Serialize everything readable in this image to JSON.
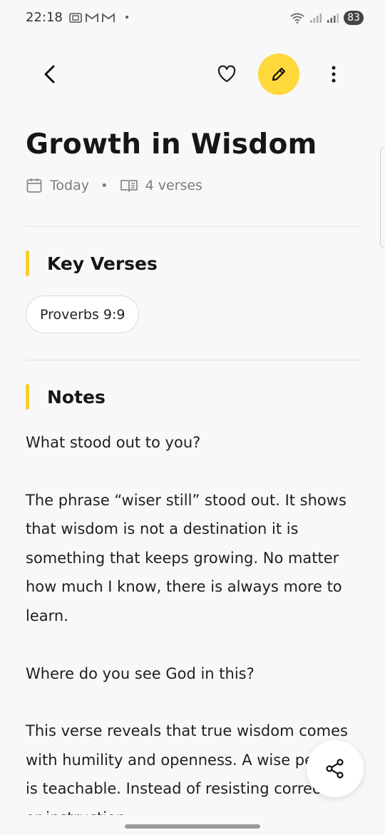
{
  "status_bar": {
    "time": "22:18",
    "dot": "•",
    "battery": "83",
    "icons": [
      "screenshot-icon",
      "gmail-icon",
      "gmail-icon",
      "wifi-icon",
      "signal-icon",
      "signal-icon"
    ]
  },
  "toolbar": {
    "icons": [
      "back-arrow-icon",
      "heart-icon",
      "pencil-icon",
      "more-vertical-icon"
    ],
    "accent_color": "#ffd83b"
  },
  "page": {
    "title": "Growth in Wisdom",
    "meta_date": "Today",
    "meta_separator": "•",
    "meta_verses": "4 verses"
  },
  "key_verses": {
    "heading": "Key Verses",
    "chips": [
      "Proverbs 9:9"
    ]
  },
  "notes": {
    "heading": "Notes",
    "paragraphs": [
      "What stood out to you?",
      "The phrase “wiser still” stood out. It shows that wisdom is not a destination it is something that keeps growing. No matter how much I know, there is always more to learn.",
      "Where do you see God in this?",
      "This verse reveals that true wisdom comes with humility and openness. A wise person is teachable. Instead of resisting correction or instruction"
    ]
  },
  "fab": {
    "icon": "share-icon"
  }
}
